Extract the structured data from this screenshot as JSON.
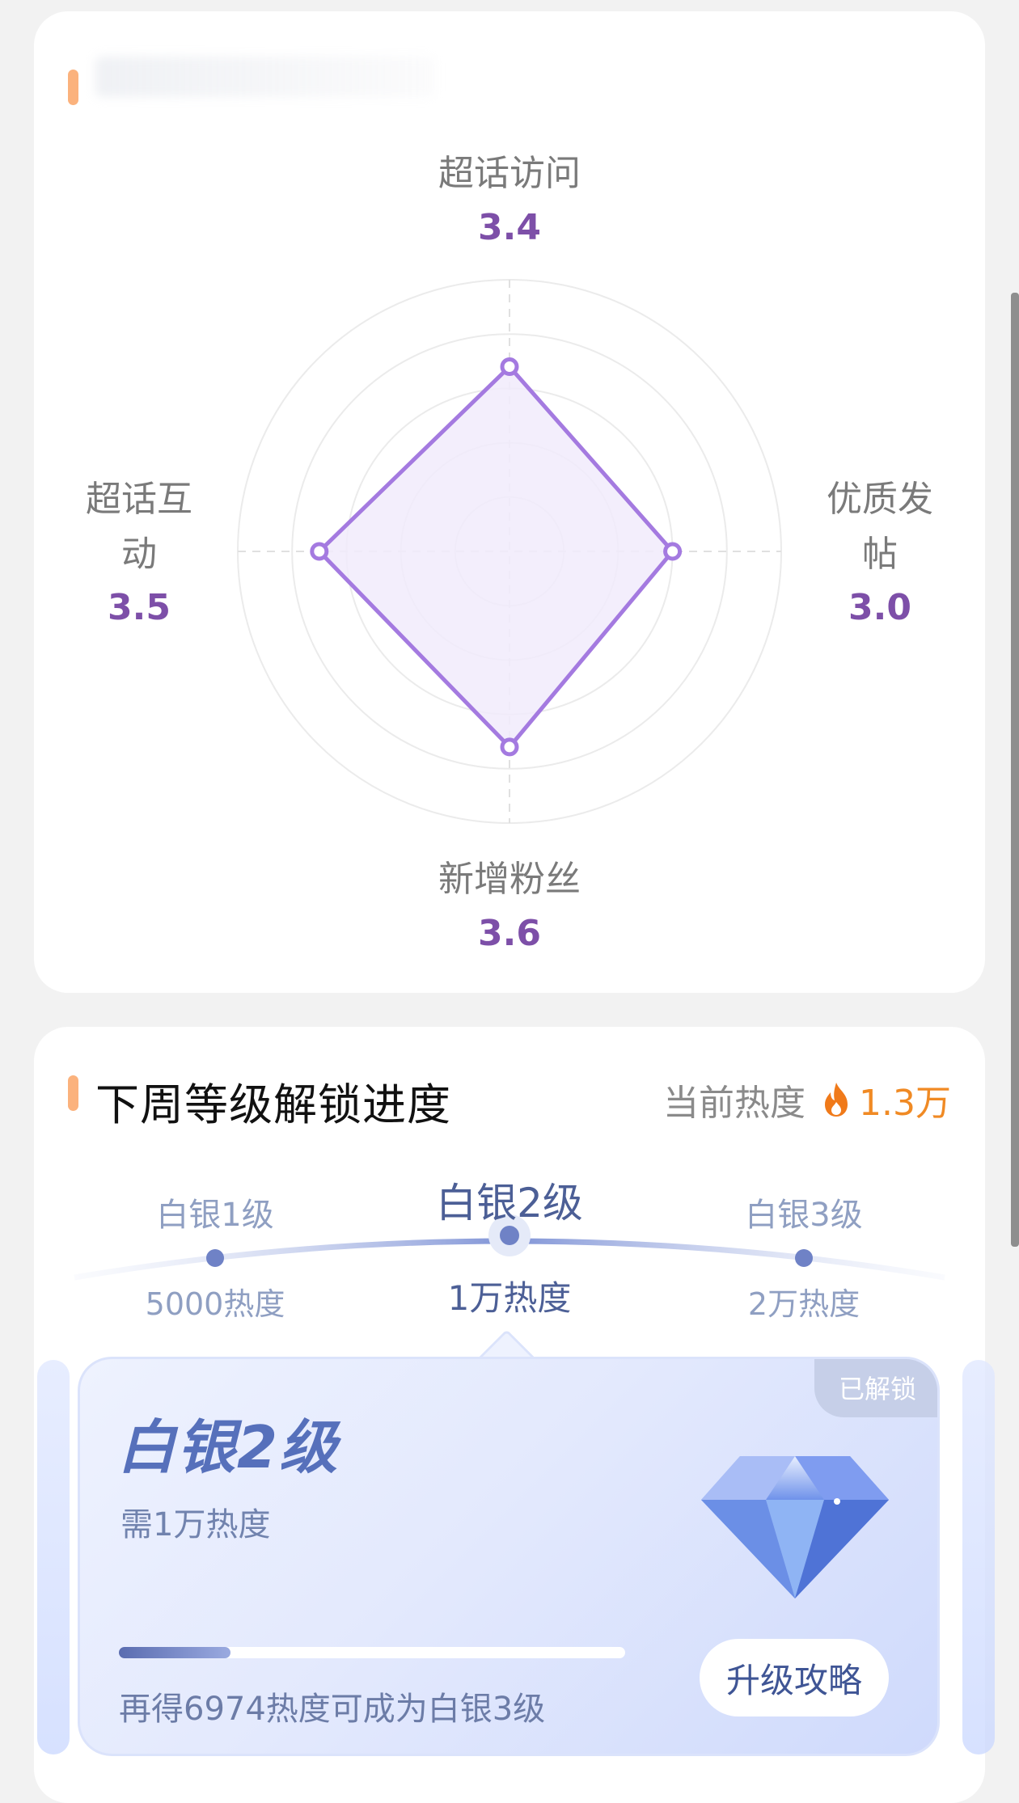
{
  "radar": {
    "axes": [
      {
        "label": "超话访问",
        "value_text": "3.4"
      },
      {
        "label": "优质发帖",
        "value_text": "3.0"
      },
      {
        "label": "新增粉丝",
        "value_text": "3.6"
      },
      {
        "label": "超话互动",
        "value_text": "3.5"
      }
    ],
    "values": [
      3.4,
      3.0,
      3.6,
      3.5
    ],
    "colors": {
      "value": "#7d4fa8",
      "label": "#7a7a7a",
      "line": "#a47ae0",
      "fill": "#f1ebfb"
    }
  },
  "unlock": {
    "title": "下周等级解锁进度",
    "heat_label": "当前热度",
    "heat_value": "1.3万",
    "levels": [
      {
        "name": "白银1级",
        "heat": "5000热度"
      },
      {
        "name": "白银2级",
        "heat": "1万热度"
      },
      {
        "name": "白银3级",
        "heat": "2万热度"
      }
    ],
    "card": {
      "badge": "已解锁",
      "level": "白银2级",
      "requirement": "需1万热度",
      "progress": 0.22,
      "hint": "再得6974热度可成为白银3级",
      "button": "升级攻略"
    }
  }
}
